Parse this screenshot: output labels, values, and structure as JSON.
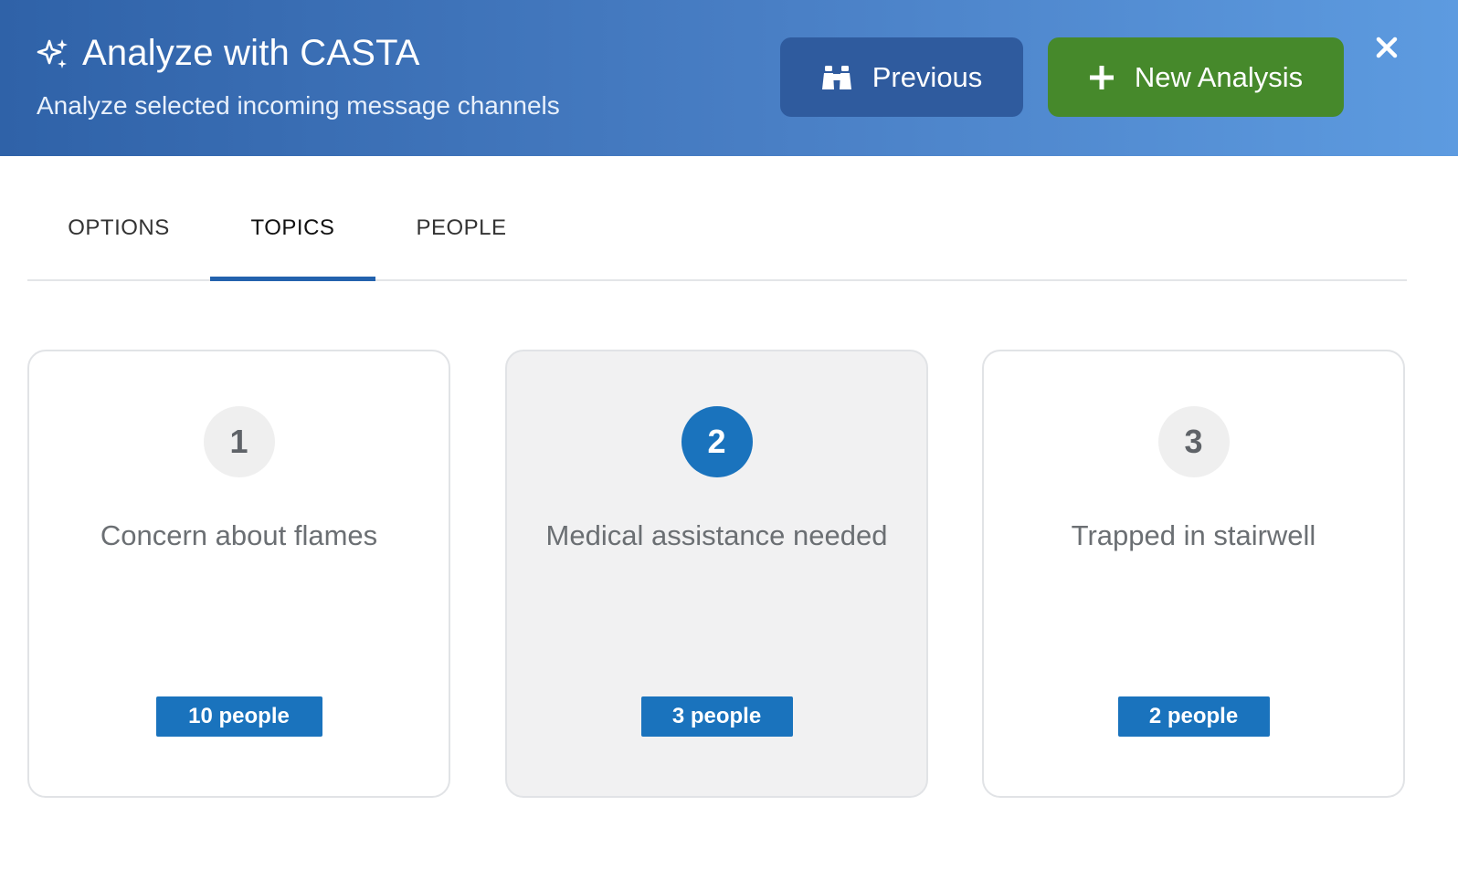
{
  "header": {
    "title": "Analyze with CASTA",
    "subtitle": "Analyze selected incoming message channels",
    "title_icon": "sparkle-icon",
    "previous_label": "Previous",
    "previous_icon": "binoculars-icon",
    "new_analysis_label": "New Analysis",
    "new_analysis_icon": "plus-icon",
    "close_icon": "close-icon"
  },
  "tabs": [
    {
      "label": "OPTIONS",
      "active": false
    },
    {
      "label": "TOPICS",
      "active": true
    },
    {
      "label": "PEOPLE",
      "active": false
    }
  ],
  "topics": [
    {
      "number": "1",
      "title": "Concern about flames",
      "count": "10 people",
      "selected": false
    },
    {
      "number": "2",
      "title": "Medical assistance needed",
      "count": "3 people",
      "selected": true
    },
    {
      "number": "3",
      "title": "Trapped in stairwell",
      "count": "2 people",
      "selected": false
    }
  ],
  "colors": {
    "header_gradient_start": "#2f62a8",
    "header_gradient_end": "#5d9be0",
    "previous_button": "#2f5b9e",
    "new_analysis_button": "#46892b",
    "accent": "#1a73bd",
    "tab_indicator": "#2362ad",
    "selected_card_bg": "#f1f1f2"
  }
}
